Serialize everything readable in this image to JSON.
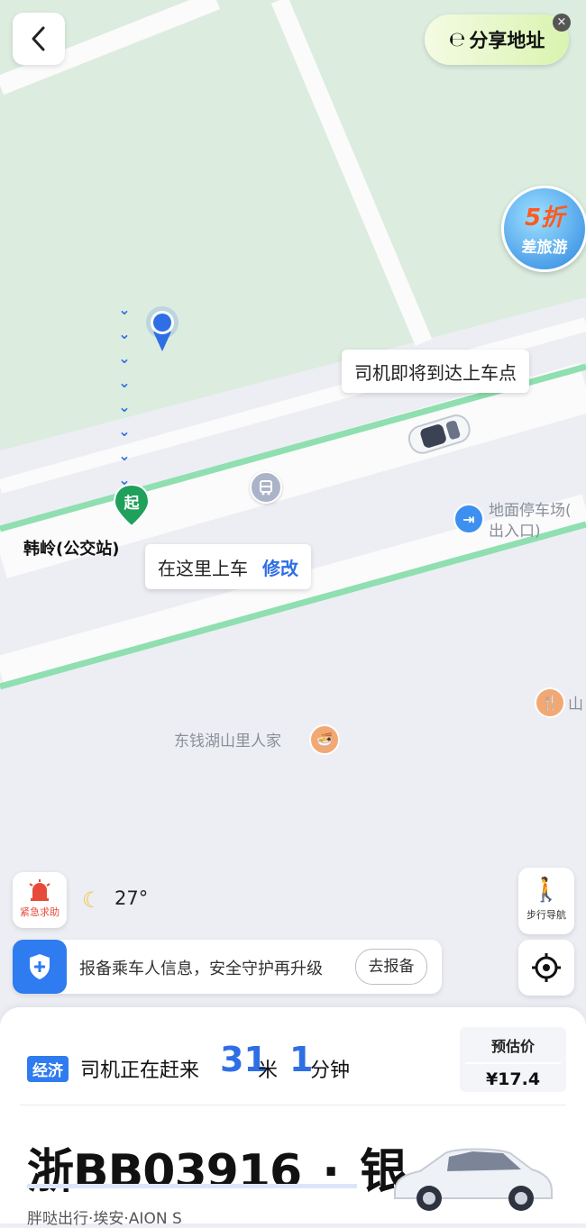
{
  "share": {
    "label": "分享地址"
  },
  "promo": {
    "discount": "5折",
    "text": "差旅游"
  },
  "map": {
    "driver_bubble": "司机即将到达上车点",
    "pickup_bubble": "在这里上车",
    "pickup_edit": "修改",
    "start_marker": "起",
    "bus_stop_name": "韩岭(公交站)",
    "parking_line1": "地面停车场(",
    "parking_line2": "出入口)",
    "poi_restaurant": "东钱湖山里人家",
    "poi_partial": "山"
  },
  "controls": {
    "sos_label": "紧急求助",
    "weather_temp": "27°",
    "walk_nav_label": "步行导航"
  },
  "safety": {
    "text": "报备乘车人信息，安全守护再升级",
    "button": "去报备"
  },
  "trip": {
    "badge": "经济",
    "status": "司机正在赶来",
    "distance_value": "31",
    "distance_unit": "米",
    "time_value": "1",
    "time_unit": "分钟",
    "price_title": "预估价",
    "price_value": "¥17.4"
  },
  "vehicle": {
    "plate": "浙BB03916",
    "separator": "·",
    "color": "银",
    "desc": "胖哒出行·埃安·AION S"
  },
  "colors": {
    "accent": "#2f6fe5",
    "green_road": "#8fdfb0",
    "park": "#dcecdf",
    "sos_red": "#e84a3a"
  }
}
